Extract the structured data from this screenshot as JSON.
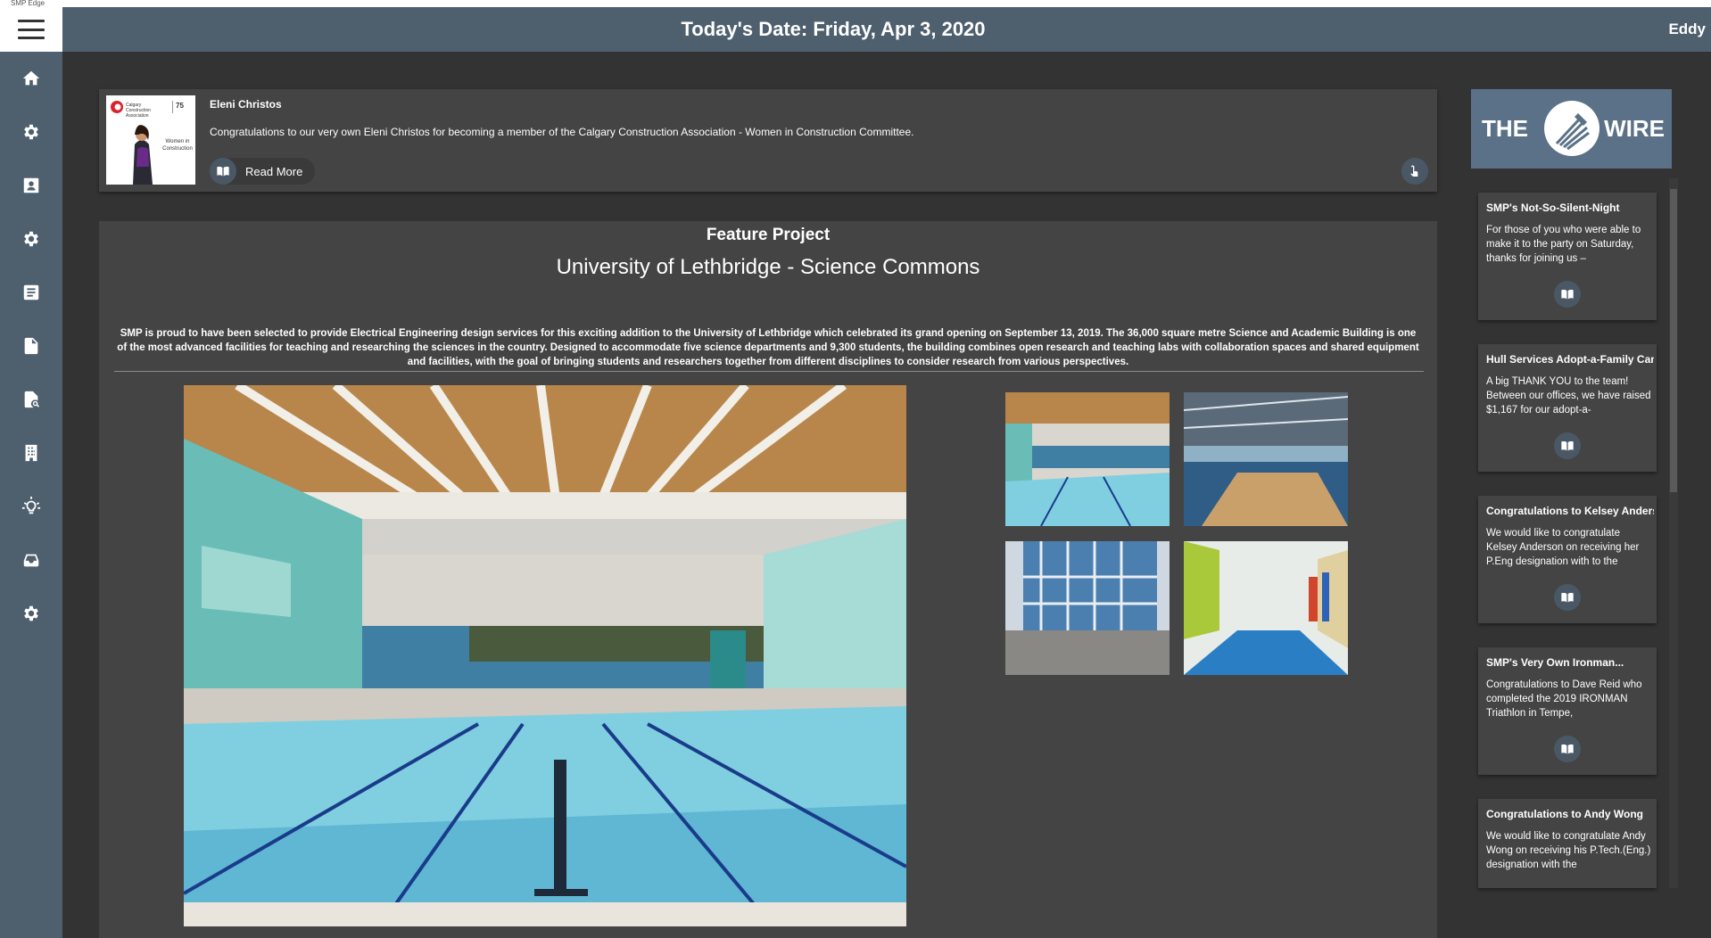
{
  "window": {
    "title": "SMP Edge"
  },
  "header": {
    "date_title": "Today's Date: Friday, Apr 3, 2020",
    "user": "Eddy"
  },
  "sidebar": {
    "items": [
      {
        "icon": "home-icon"
      },
      {
        "icon": "gear-icon"
      },
      {
        "icon": "contact-card-icon"
      },
      {
        "icon": "gear-icon"
      },
      {
        "icon": "article-icon"
      },
      {
        "icon": "document-icon"
      },
      {
        "icon": "document-search-icon"
      },
      {
        "icon": "building-icon"
      },
      {
        "icon": "lightbulb-icon"
      },
      {
        "icon": "inbox-tray-icon"
      },
      {
        "icon": "gear-icon"
      }
    ]
  },
  "news": {
    "author": "Eleni Christos",
    "text": "Congratulations to our very own Eleni Christos for becoming a member of the Calgary Construction Association - Women in Construction Committee.",
    "read_more": "Read More",
    "thumb": {
      "org": "Calgary Construction Association",
      "badge": "75",
      "caption": "Women in Construction"
    }
  },
  "feature": {
    "label": "Feature Project",
    "title": "University of Lethbridge - Science Commons",
    "description": "SMP is proud to have been selected to provide Electrical Engineering design services for this exciting addition to the University of Lethbridge which celebrated its grand opening on September 13, 2019. The 36,000 square metre Science and Academic Building is one of the most advanced facilities for teaching and researching the sciences in the country. Designed to accommodate five science departments and 9,300 students, the building combines open research and teaching labs with collaboration spaces and shared equipment and facilities, with the goal of bringing students and researchers together from different disciplines to consider research from various perspectives."
  },
  "wire": {
    "left": "THE",
    "right": "WIRE",
    "posts": [
      {
        "title": "SMP's Not-So-Silent-Night",
        "body": "For those of you who were able to make it to the party on Saturday, thanks for joining us –"
      },
      {
        "title": "Hull Services Adopt-a-Family Campaign",
        "body": "A big THANK YOU to the team! Between our offices, we have raised $1,167 for our adopt-a-"
      },
      {
        "title": "Congratulations to Kelsey Anderson",
        "body": "We would like to congratulate Kelsey Anderson on receiving her P.Eng designation with to the"
      },
      {
        "title": "SMP's Very Own Ironman...",
        "body": "Congratulations to Dave Reid who completed the 2019 IRONMAN Triathlon in Tempe,"
      },
      {
        "title": "Congratulations to Andy Wong",
        "body": "We would like to congratulate Andy Wong on receiving his P.Tech.(Eng.) designation with the"
      }
    ]
  },
  "colors": {
    "header_bg": "#4e5f6e",
    "page_bg": "#333333",
    "card_bg": "#444444",
    "wire_bg": "#5b7187"
  }
}
